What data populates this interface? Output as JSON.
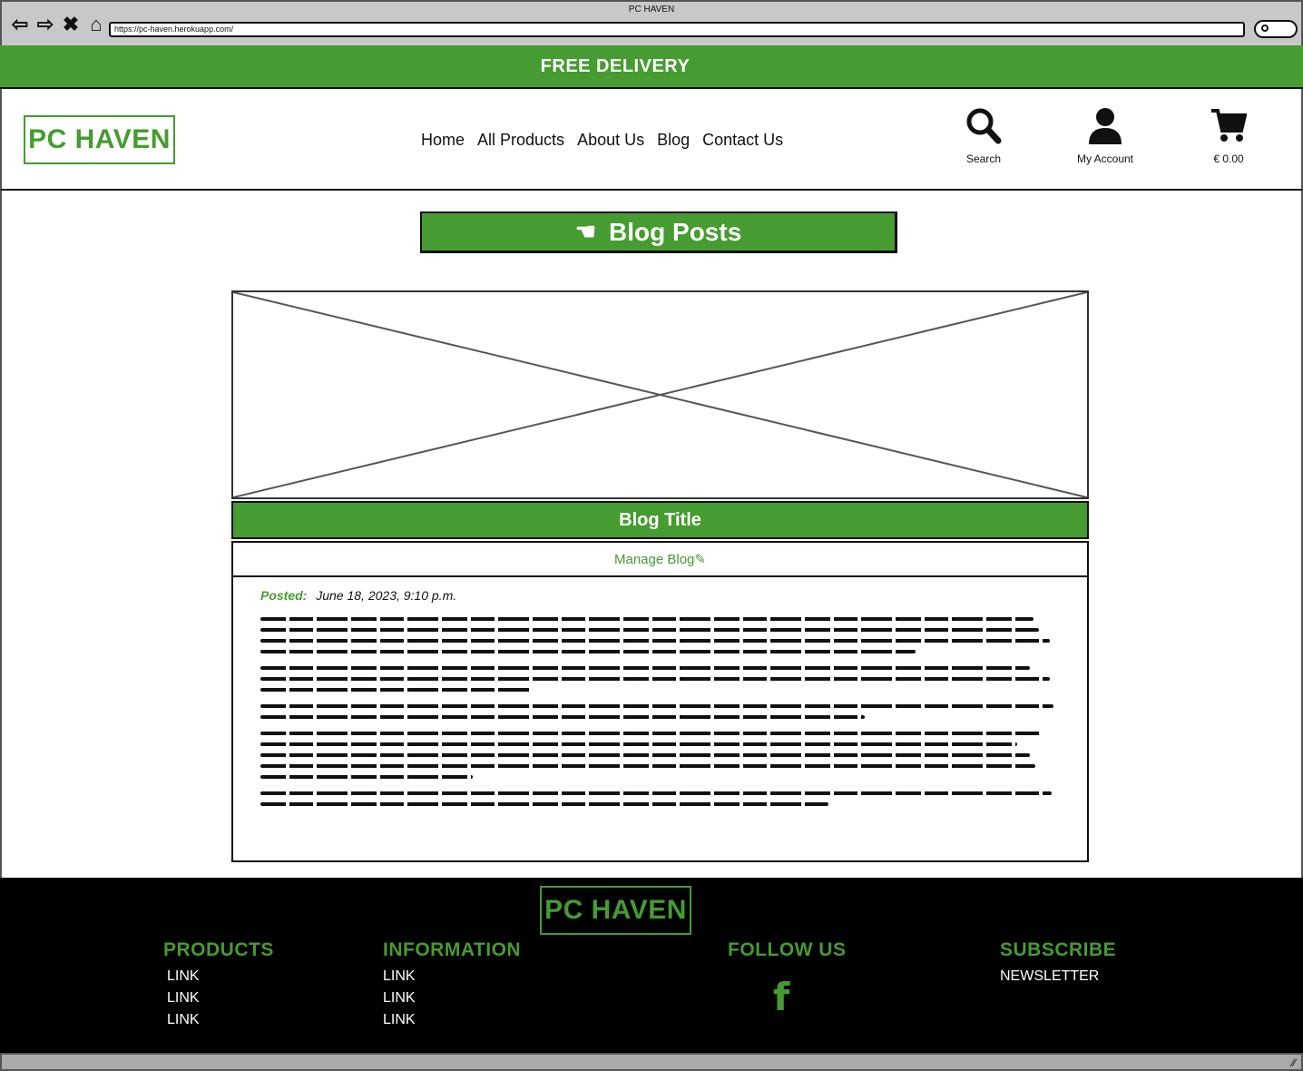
{
  "browser": {
    "title": "PC HAVEN",
    "url": "https://pc-haven.herokuapp.com/",
    "icons": [
      "back-arrow-icon",
      "forward-arrow-icon",
      "close-icon",
      "home-icon",
      "search-icon"
    ]
  },
  "banner": {
    "text": "FREE DELIVERY"
  },
  "header": {
    "logo": "PC HAVEN",
    "nav": [
      "Home",
      "All Products",
      "About Us",
      "Blog",
      "Contact Us"
    ],
    "search_label": "Search",
    "account_label": "My Account",
    "cart_label": "€ 0.00"
  },
  "page": {
    "heading": "Blog Posts",
    "heading_icon": "pointing-hand-icon"
  },
  "blog": {
    "image_icon": "image-placeholder-icon",
    "title": "Blog Title",
    "manage_label": "Manage Blog",
    "manage_icon": "pencil-icon",
    "posted_label": "Posted:",
    "posted_date": "June 18, 2023, 9:10 p.m."
  },
  "footer": {
    "logo": "PC HAVEN",
    "products": {
      "title": "PRODUCTS",
      "links": [
        "LINK",
        "LINK",
        "LINK"
      ]
    },
    "information": {
      "title": "INFORMATION",
      "links": [
        "LINK",
        "LINK",
        "LINK"
      ]
    },
    "follow": {
      "title": "FOLLOW US",
      "icon": "facebook-icon"
    },
    "subscribe": {
      "title": "SUBSCRIBE",
      "link": "NEWSLETTER"
    }
  },
  "colors": {
    "brand_green": "#469b31",
    "footer_bg": "#000000",
    "chrome_gray": "#c8c8c8"
  }
}
